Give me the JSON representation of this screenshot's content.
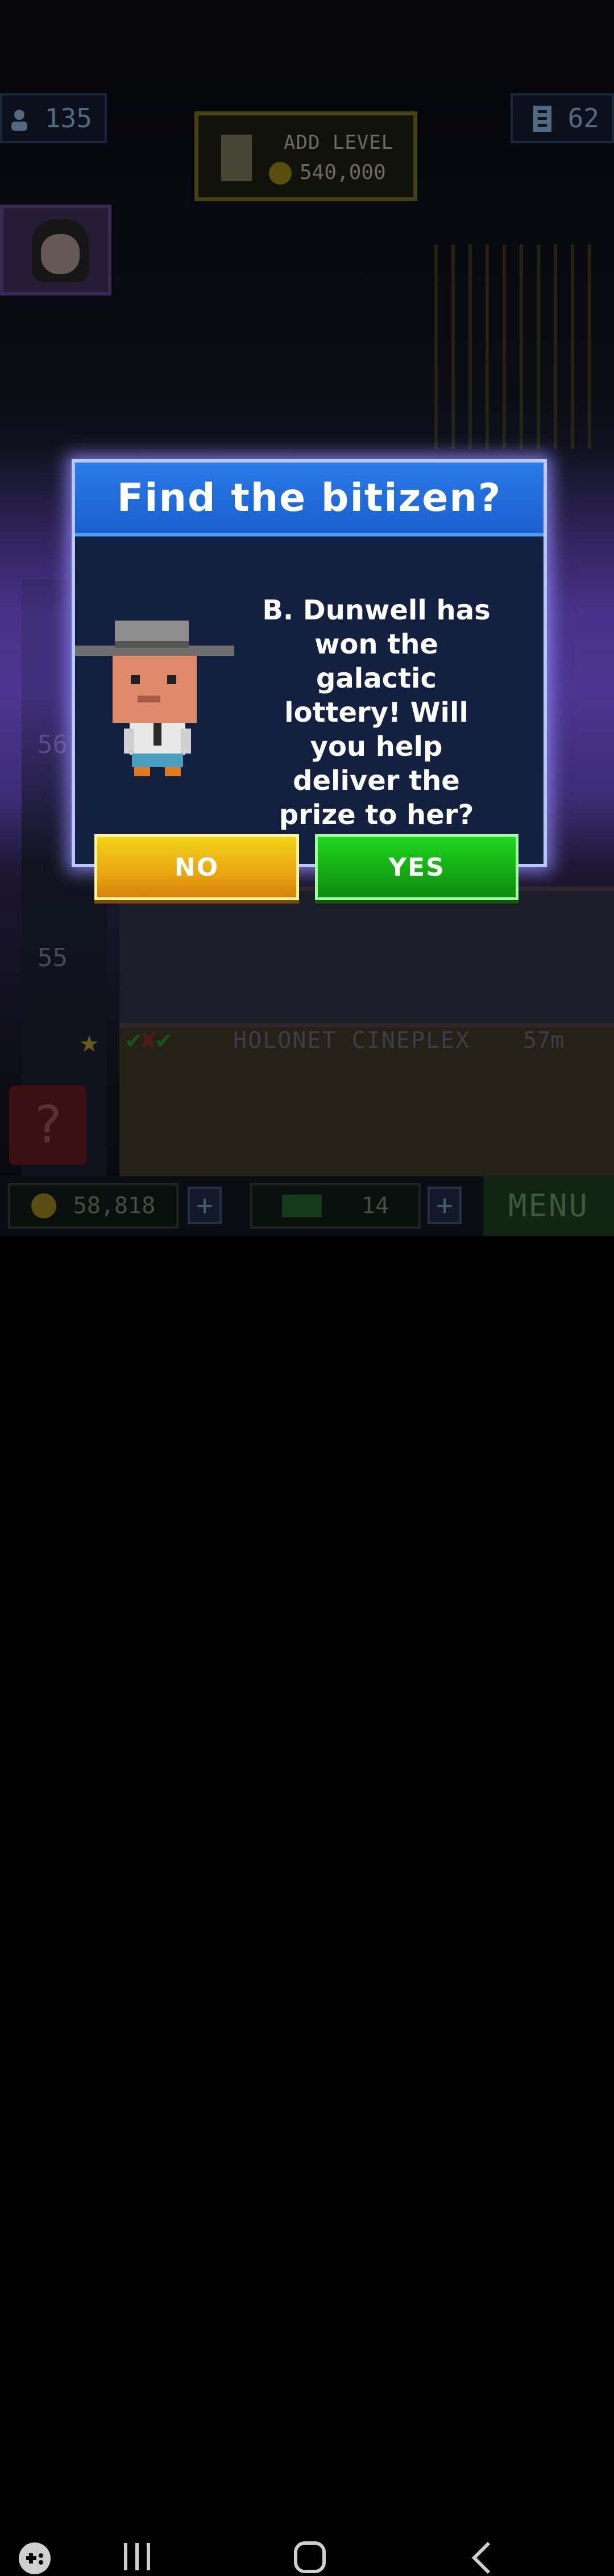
{
  "hud": {
    "population": "135",
    "floors": "62",
    "add_level_label": "ADD LEVEL",
    "add_level_cost": "540,000",
    "coins": "58,818",
    "bux": "14",
    "menu_label": "MENU",
    "floor_name": "HOLONET CINEPLEX",
    "floor_distance": "57m",
    "floor_number_1": "56",
    "floor_number_2": "55",
    "plus_label": "+",
    "mystery_label": "?"
  },
  "dialog": {
    "title": "Find the bitizen?",
    "message": "B. Dunwell has won the galactic lottery! Will you help deliver the prize to her?",
    "no_label": "NO",
    "yes_label": "YES"
  },
  "colors": {
    "dialog_title_bg": "#1a5fcf",
    "dialog_body_bg": "#142040",
    "no_button": "#e8a612",
    "yes_button": "#14a814",
    "glow": "#7850e6"
  },
  "icons": {
    "population": "person-icon",
    "floors": "building-icon",
    "add_level": "add-floor-icon",
    "coin": "coin-icon",
    "bux": "bux-icon",
    "nav_game": "game-launcher-icon",
    "nav_recents": "recents-icon",
    "nav_home": "home-icon",
    "nav_back": "back-icon"
  }
}
